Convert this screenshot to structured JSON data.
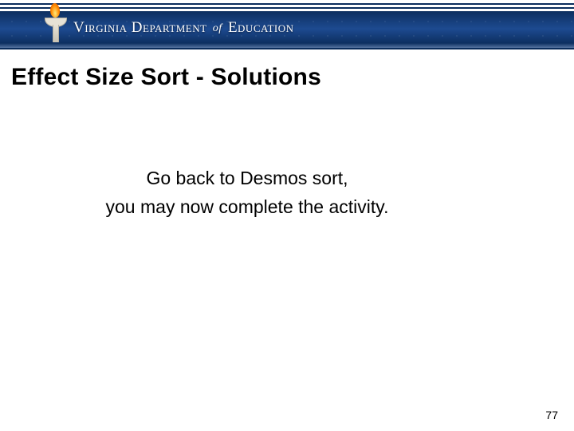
{
  "header": {
    "org_name_pre": "Virginia Department ",
    "org_name_of": "of",
    "org_name_post": " Education"
  },
  "title": "Effect Size Sort - Solutions",
  "body": {
    "line1": "Go back to Desmos sort,",
    "line2": "you may now complete the activity."
  },
  "page_number": "77"
}
